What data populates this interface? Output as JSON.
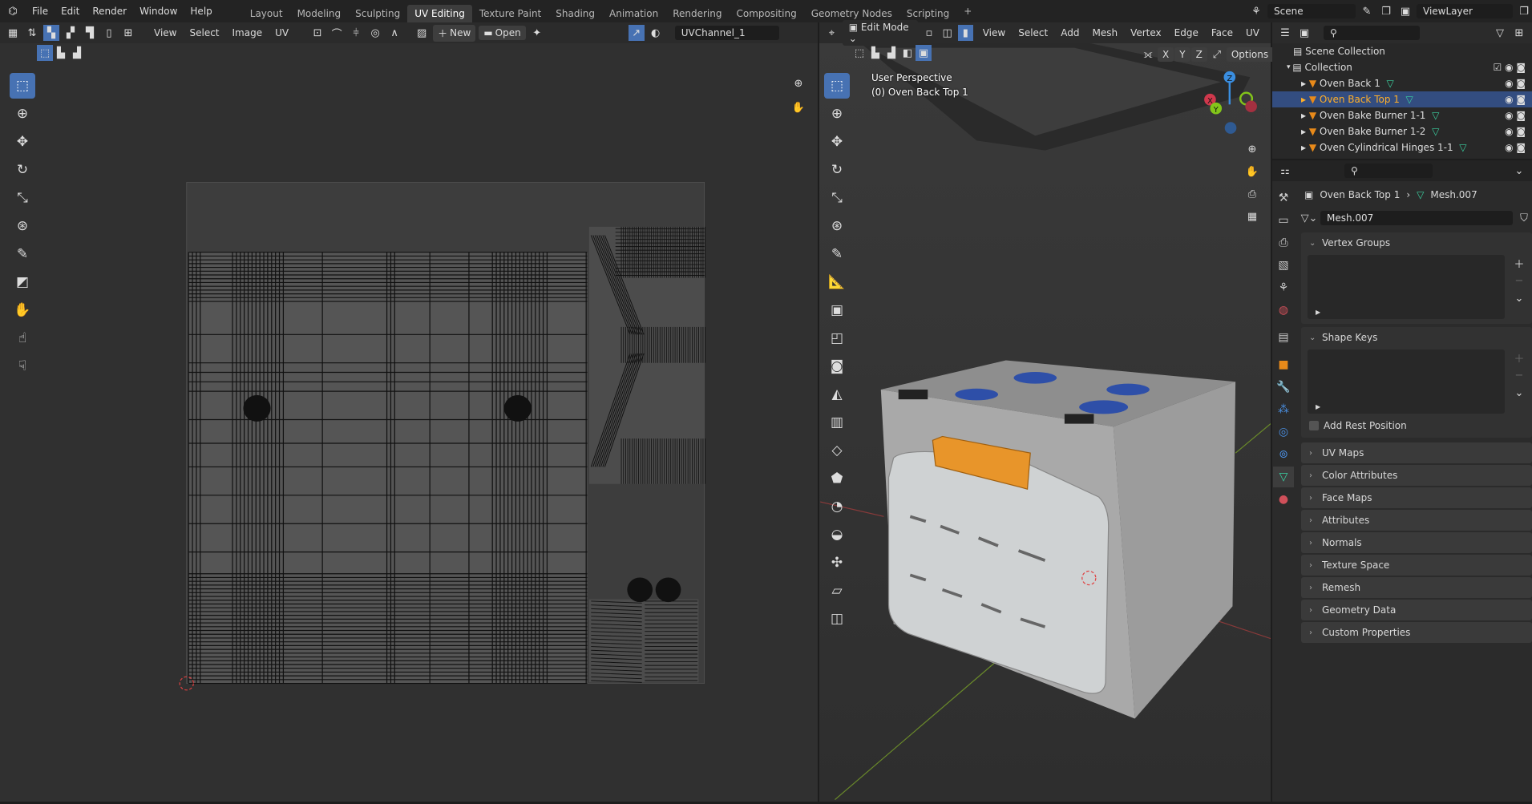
{
  "topbar": {
    "logo": "blender-logo",
    "menus": [
      "File",
      "Edit",
      "Render",
      "Window",
      "Help"
    ],
    "workspaces": [
      "Layout",
      "Modeling",
      "Sculpting",
      "UV Editing",
      "Texture Paint",
      "Shading",
      "Animation",
      "Rendering",
      "Compositing",
      "Geometry Nodes",
      "Scripting"
    ],
    "active_workspace": "UV Editing",
    "add_workspace": "+",
    "scene": "Scene",
    "view_layer": "ViewLayer"
  },
  "uv_editor": {
    "header_menus": [
      "View",
      "Select",
      "Image",
      "UV"
    ],
    "new_label": "New",
    "open_label": "Open",
    "uv_channel": "UVChannel_1",
    "tools": [
      "select-box",
      "cursor",
      "move",
      "rotate",
      "scale",
      "transform",
      "annotate",
      "rip-region",
      "grab",
      "relax",
      "pinch"
    ]
  },
  "viewport": {
    "mode": "Edit Mode",
    "header_menus": [
      "View",
      "Select",
      "Add",
      "Mesh",
      "Vertex",
      "Edge",
      "Face",
      "UV"
    ],
    "axes": [
      "X",
      "Y",
      "Z"
    ],
    "options_label": "Options",
    "overlay_line1": "User Perspective",
    "overlay_line2": "(0) Oven Back Top 1",
    "gizmo": {
      "x": "X",
      "y": "Y",
      "z": "Z"
    },
    "tools": [
      "select-box",
      "cursor",
      "move",
      "rotate",
      "scale",
      "transform",
      "annotate",
      "measure",
      "add-cube",
      "extrude",
      "inset",
      "bevel",
      "loop-cut",
      "knife",
      "poly-build",
      "spin",
      "smooth",
      "shrink-fatten",
      "shear",
      "rip"
    ]
  },
  "outliner": {
    "scene_collection": "Scene Collection",
    "collection": "Collection",
    "items": [
      {
        "name": "Oven Back 1",
        "selected": false
      },
      {
        "name": "Oven Back Top 1",
        "selected": true
      },
      {
        "name": "Oven Bake Burner 1-1",
        "selected": false
      },
      {
        "name": "Oven Bake Burner 1-2",
        "selected": false
      },
      {
        "name": "Oven Cylindrical Hinges 1-1",
        "selected": false
      }
    ]
  },
  "properties": {
    "object": "Oven Back Top 1",
    "mesh": "Mesh.007",
    "mesh_field": "Mesh.007",
    "vertex_groups": "Vertex Groups",
    "shape_keys": "Shape Keys",
    "add_rest_position": "Add Rest Position",
    "add_rest_position_checked": false,
    "panels": [
      "UV Maps",
      "Color Attributes",
      "Face Maps",
      "Attributes",
      "Normals",
      "Texture Space",
      "Remesh",
      "Geometry Data",
      "Custom Properties"
    ],
    "tabs": [
      "tool",
      "render",
      "output",
      "view-layer",
      "scene",
      "world",
      "collection",
      "object",
      "modifiers",
      "particles",
      "physics",
      "constraints",
      "data",
      "material"
    ],
    "active_tab": "data"
  },
  "colors": {
    "accent": "#4772b3",
    "selected_text": "#ffaf29",
    "mesh_orange": "#e88a1a",
    "mesh_data_green": "#3bd1a1"
  }
}
